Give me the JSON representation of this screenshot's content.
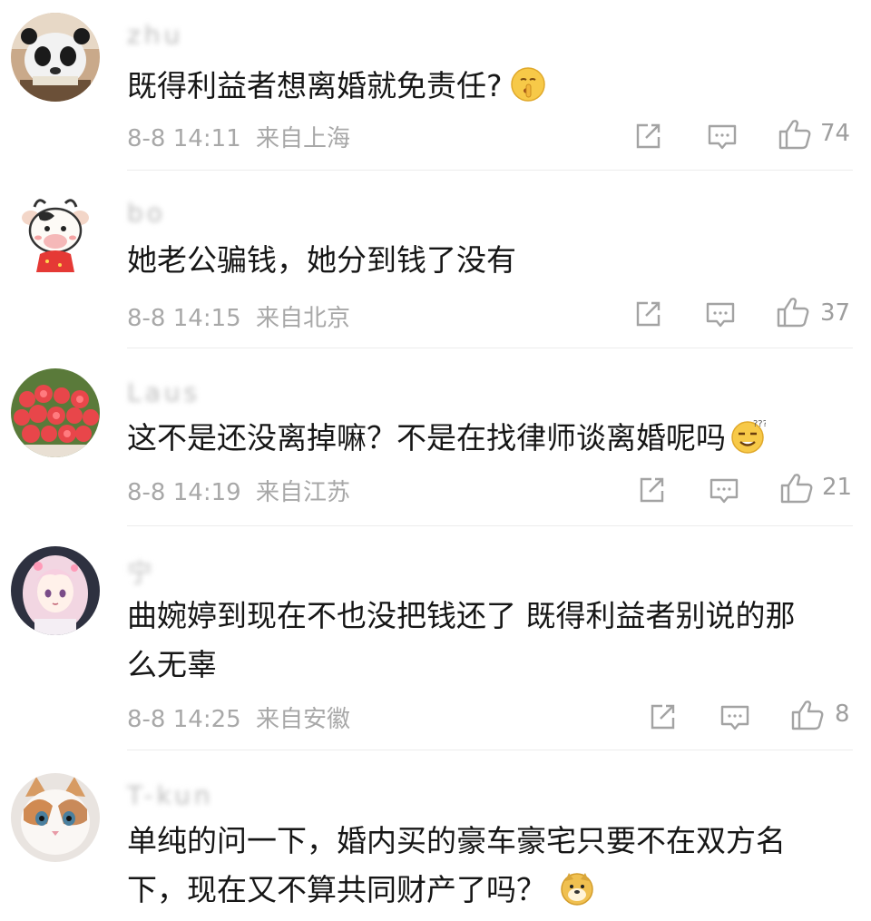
{
  "comments": [
    {
      "username": "zhu",
      "text": "既得利益者想离婚就免责任?",
      "time": "8-8 14:11",
      "location": "来自上海",
      "likes": "74",
      "emoji": "shushing-face"
    },
    {
      "username": "bo",
      "text": "她老公骗钱，她分到钱了没有",
      "time": "8-8 14:15",
      "location": "来自北京",
      "likes": "37"
    },
    {
      "username": "Laus",
      "text": "这不是还没离掉嘛？不是在找律师谈离婚呢吗",
      "time": "8-8 14:19",
      "location": "来自江苏",
      "likes": "21",
      "emoji": "sweat-smile-face"
    },
    {
      "username": "宁",
      "text": "曲婉婷到现在不也没把钱还了 既得利益者别说的那\n么无辜",
      "time": "8-8 14:25",
      "location": "来自安徽",
      "likes": "8"
    },
    {
      "username": "T-kun",
      "text": "单纯的问一下，婚内买的豪车豪宅只要不在双方名\n下，现在又不算共同财产了吗？",
      "emoji": "doge-face"
    }
  ],
  "colors": {
    "meta": "#a8a8a8",
    "text": "#161616",
    "divider": "#ececec"
  }
}
